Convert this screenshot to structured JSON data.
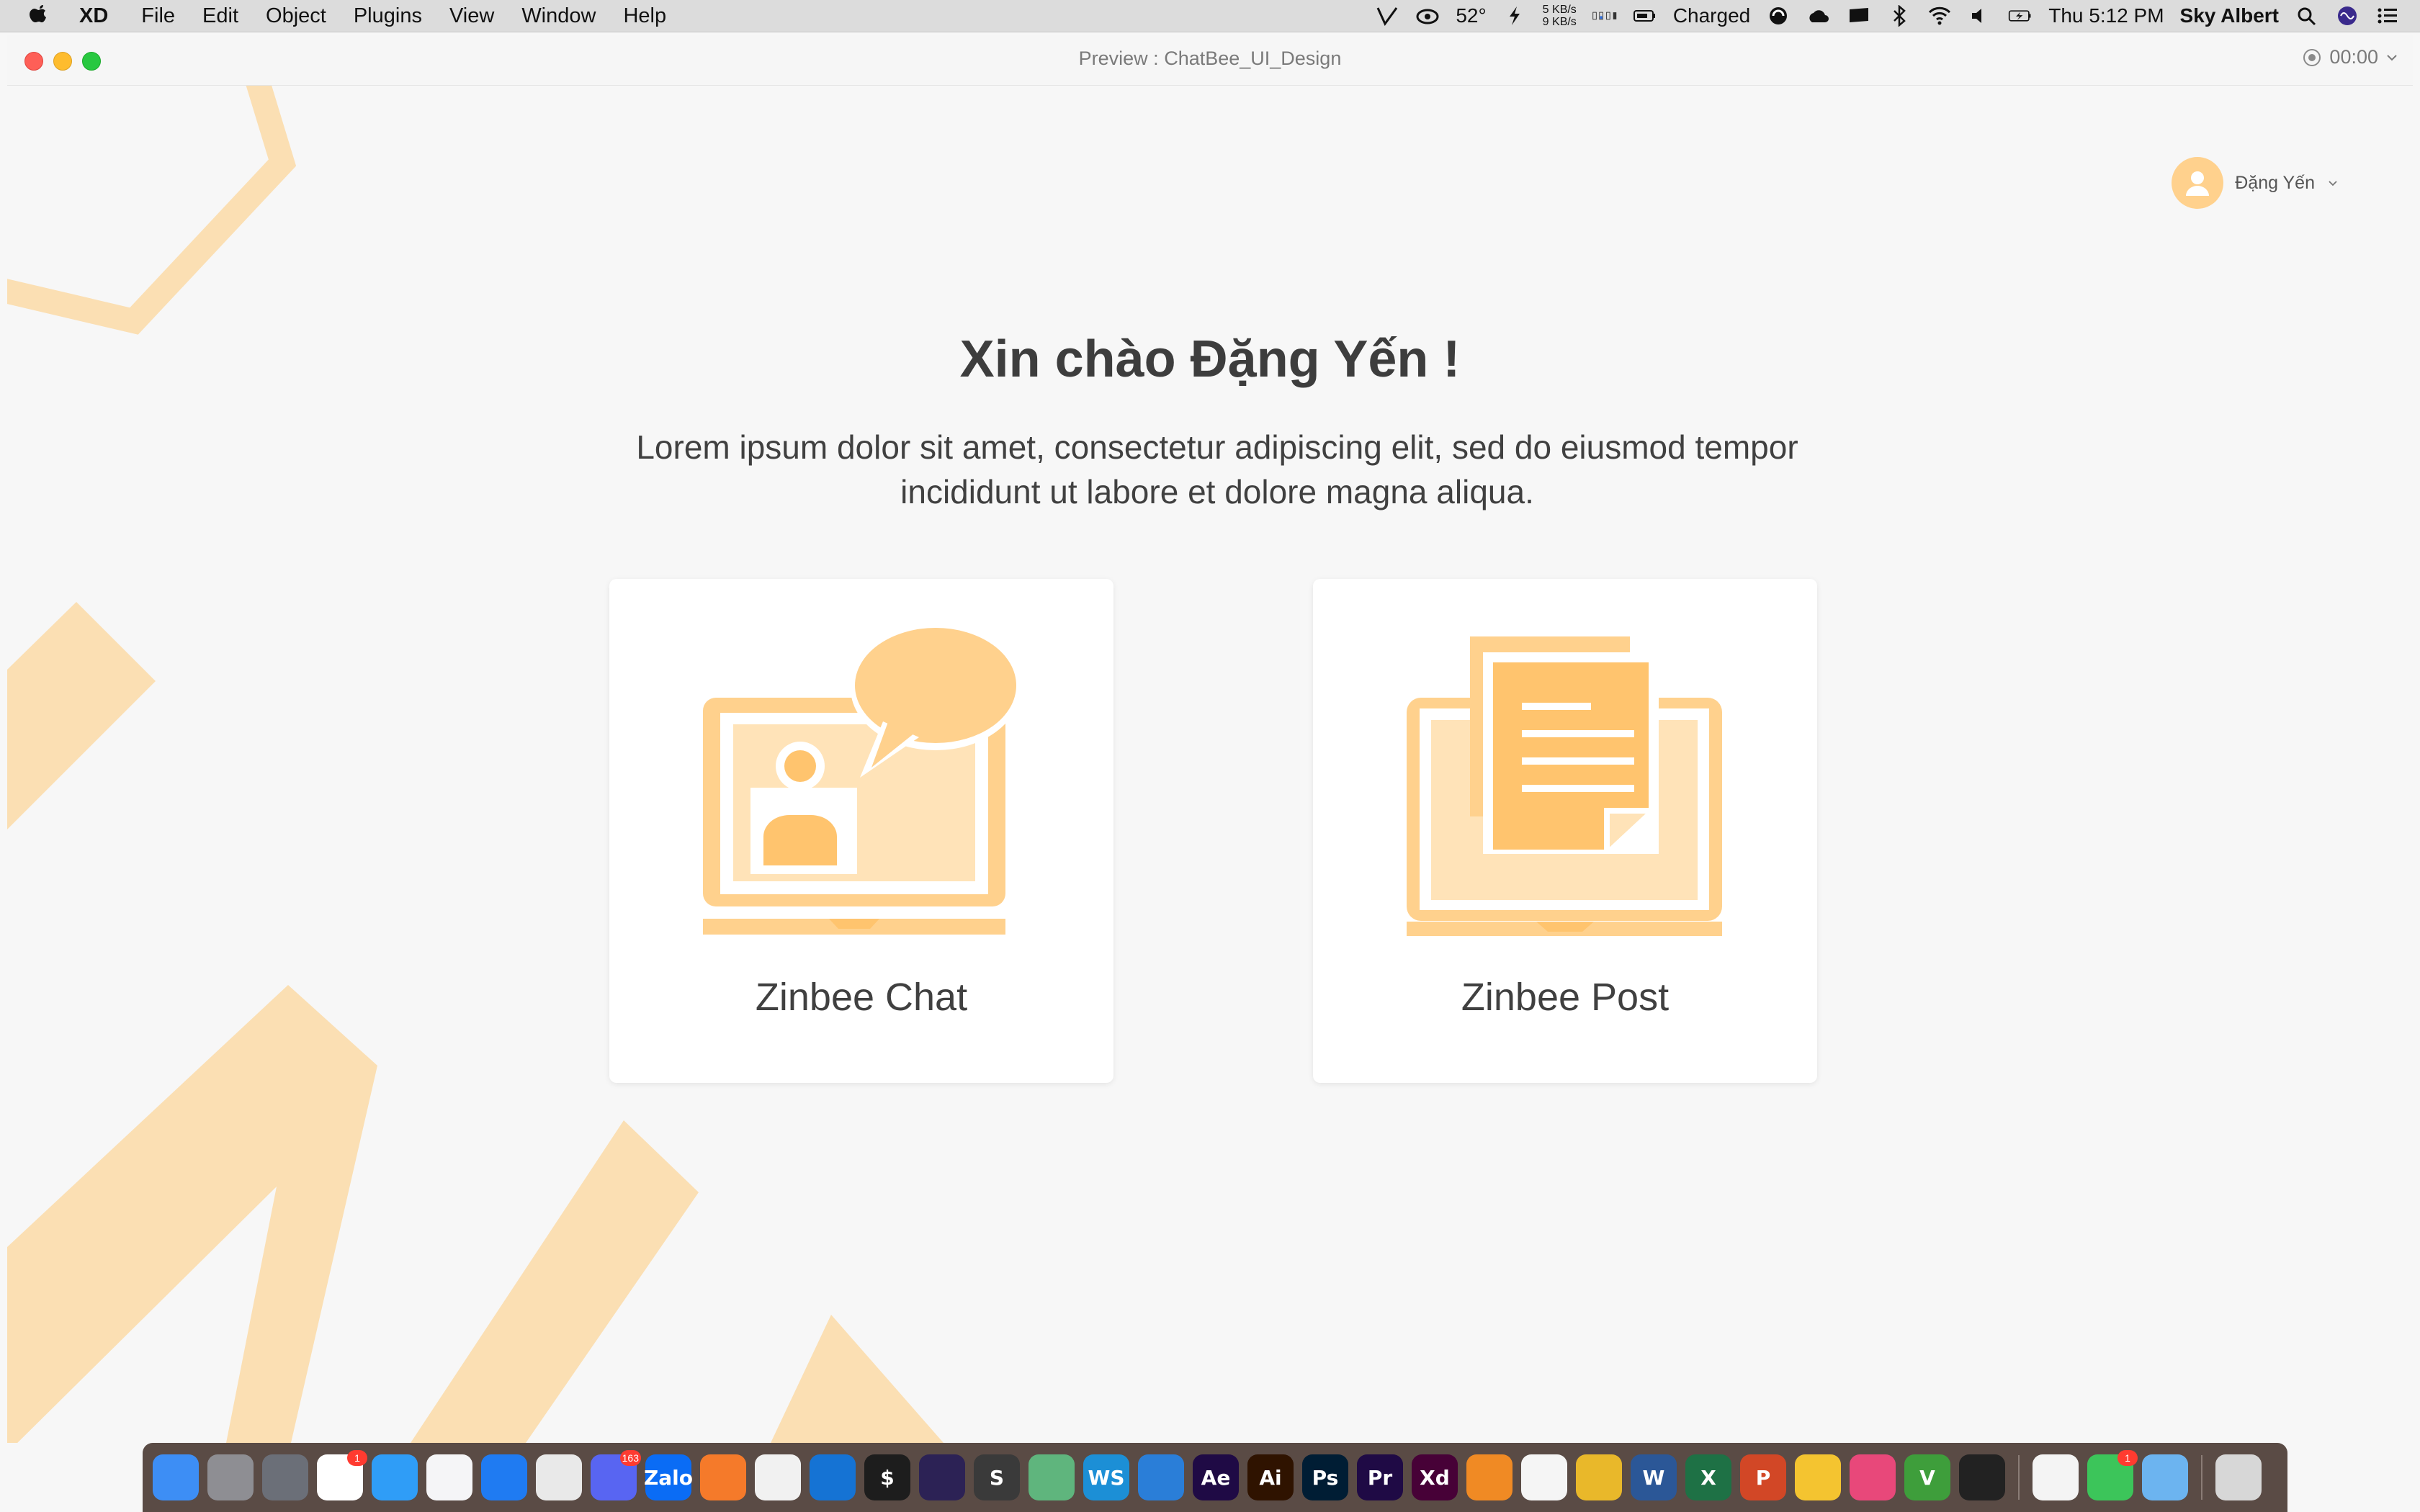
{
  "menubar": {
    "app_name": "XD",
    "menus": [
      "File",
      "Edit",
      "Object",
      "Plugins",
      "View",
      "Window",
      "Help"
    ],
    "tray": {
      "weather": "52°",
      "net_up": "5 KB/s",
      "net_down": "9 KB/s",
      "battery_status": "Charged",
      "clock": "Thu 5:12 PM",
      "user": "Sky Albert"
    }
  },
  "window": {
    "title": "Preview : ChatBee_UI_Design",
    "timer": "00:00"
  },
  "page": {
    "user_name": "Đặng Yến",
    "greeting": "Xin chào Đặng Yến !",
    "subtitle_line1": "Lorem ipsum dolor sit amet, consectetur adipiscing elit, sed do eiusmod tempor",
    "subtitle_line2": "incididunt ut labore et dolore magna aliqua.",
    "cards": [
      {
        "label": "Zinbee Chat",
        "icon": "chat-laptop-icon"
      },
      {
        "label": "Zinbee Post",
        "icon": "document-laptop-icon"
      }
    ]
  },
  "colors": {
    "accent": "#ffd18d",
    "accent_light": "#ffe3b8",
    "accent_dark": "#ffc46e",
    "deco": "#fbdfb3",
    "background": "#f7f7f7"
  },
  "dock": {
    "apps": [
      {
        "name": "Finder",
        "icon": "finder-icon",
        "label": "",
        "color": "#3d8ef5"
      },
      {
        "name": "System Preferences",
        "icon": "gear-icon",
        "label": "",
        "color": "#8e8e93"
      },
      {
        "name": "Launchpad",
        "icon": "rocket-icon",
        "label": "",
        "color": "#6b6f78"
      },
      {
        "name": "Reminders",
        "icon": "reminders-icon",
        "label": "",
        "color": "#ffffff",
        "badge": "1"
      },
      {
        "name": "Messages",
        "icon": "messages-icon",
        "label": "",
        "color": "#2f9df7"
      },
      {
        "name": "iTunes",
        "icon": "music-icon",
        "label": "",
        "color": "#f5f5f7"
      },
      {
        "name": "Safari",
        "icon": "compass-icon",
        "label": "",
        "color": "#1f7bf2"
      },
      {
        "name": "Chrome",
        "icon": "chrome-icon",
        "label": "",
        "color": "#e9e9e9"
      },
      {
        "name": "Discord",
        "icon": "discord-icon",
        "label": "",
        "color": "#5865f2",
        "badge": "163"
      },
      {
        "name": "Zalo",
        "icon": "zalo-icon",
        "label": "Zalo",
        "color": "#0a6cf5"
      },
      {
        "name": "Pages",
        "icon": "pen-icon",
        "label": "",
        "color": "#f57a2a"
      },
      {
        "name": "MongoDB",
        "icon": "leaf-icon",
        "label": "",
        "color": "#f1f1f1"
      },
      {
        "name": "Trello",
        "icon": "trello-icon",
        "label": "",
        "color": "#1573d4"
      },
      {
        "name": "Terminal",
        "icon": "terminal-icon",
        "label": "$",
        "color": "#1d1d1d"
      },
      {
        "name": "Eclipse",
        "icon": "eclipse-icon",
        "label": "",
        "color": "#2c2255"
      },
      {
        "name": "Sublime Text",
        "icon": "sublime-icon",
        "label": "S",
        "color": "#3a3a3a"
      },
      {
        "name": "Atom",
        "icon": "atom-icon",
        "label": "",
        "color": "#5fb57d"
      },
      {
        "name": "WebStorm",
        "icon": "webstorm-icon",
        "label": "WS",
        "color": "#1c8fd6"
      },
      {
        "name": "VS Code",
        "icon": "vscode-icon",
        "label": "",
        "color": "#2a7ed8"
      },
      {
        "name": "After Effects",
        "icon": "after-effects-icon",
        "label": "Ae",
        "color": "#1f0a45"
      },
      {
        "name": "Illustrator",
        "icon": "illustrator-icon",
        "label": "Ai",
        "color": "#2f1300"
      },
      {
        "name": "Photoshop",
        "icon": "photoshop-icon",
        "label": "Ps",
        "color": "#001d34"
      },
      {
        "name": "Premiere",
        "icon": "premiere-icon",
        "label": "Pr",
        "color": "#1f0a45"
      },
      {
        "name": "Adobe XD",
        "icon": "xd-icon",
        "label": "Xd",
        "color": "#470137"
      },
      {
        "name": "Transmit",
        "icon": "airship-icon",
        "label": "",
        "color": "#f08a24"
      },
      {
        "name": "Emoji",
        "icon": "smiley-icon",
        "label": "",
        "color": "#f5f5f5"
      },
      {
        "name": "Reeder",
        "icon": "star-icon",
        "label": "",
        "color": "#e9b82a"
      },
      {
        "name": "Word",
        "icon": "word-icon",
        "label": "W",
        "color": "#2b5797"
      },
      {
        "name": "Excel",
        "icon": "excel-icon",
        "label": "X",
        "color": "#1e7145"
      },
      {
        "name": "PowerPoint",
        "icon": "powerpoint-icon",
        "label": "P",
        "color": "#d24726"
      },
      {
        "name": "Cyberduck",
        "icon": "duck-icon",
        "label": "",
        "color": "#f4c430"
      },
      {
        "name": "CleanMyMac",
        "icon": "cleanmymac-icon",
        "label": "",
        "color": "#e8487a"
      },
      {
        "name": "Vim",
        "icon": "vim-icon",
        "label": "V",
        "color": "#3e9e3b"
      },
      {
        "name": "Console",
        "icon": "console-icon",
        "label": "",
        "color": "#222222"
      },
      {
        "name": "TextEdit",
        "icon": "textedit-icon",
        "label": "",
        "color": "#f4f4f4"
      },
      {
        "name": "FaceTime",
        "icon": "facetime-icon",
        "label": "",
        "color": "#3cc55a",
        "badge": "1"
      },
      {
        "name": "Downloads",
        "icon": "folder-icon",
        "label": "",
        "color": "#6cb4f0"
      },
      {
        "name": "Trash",
        "icon": "trash-icon",
        "label": "",
        "color": "#d7d7d7"
      }
    ]
  }
}
